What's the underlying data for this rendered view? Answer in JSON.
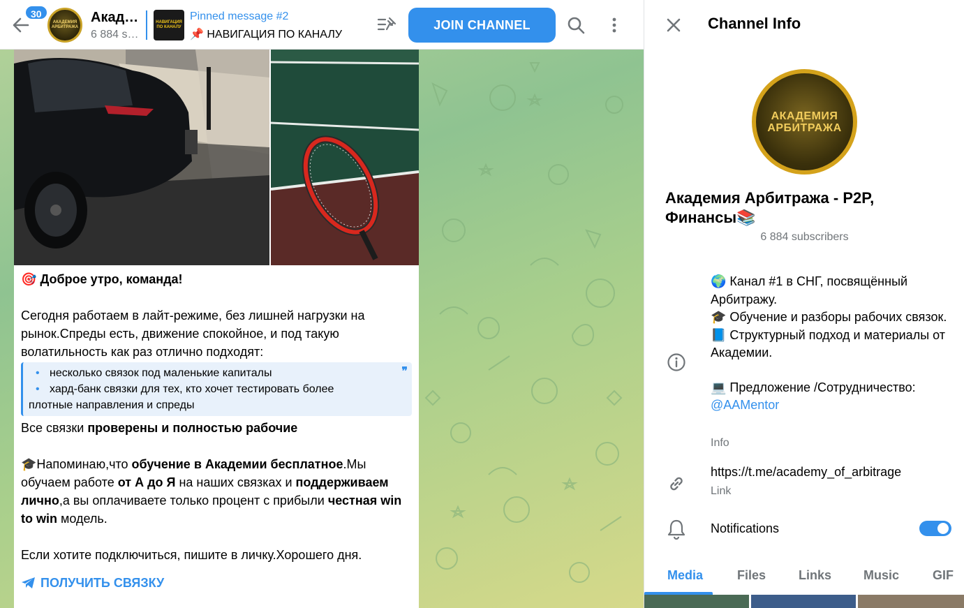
{
  "header": {
    "unread_count": "30",
    "chat_title": "Академия Арбитража - P2P, Финансы",
    "chat_subtitle": "6 884 subscribers",
    "avatar_text": "АКАДЕМИЯ АРБИТРАЖА",
    "pinned_title": "Pinned message #2",
    "pinned_thumb_text": "НАВИГАЦИЯ ПО КАНАЛУ",
    "pinned_text": "📌 НАВИГАЦИЯ ПО КАНАЛУ",
    "join_label": "JOIN CHANNEL"
  },
  "message": {
    "greeting_icon": "🎯",
    "greeting": "Доброе утро, команда!",
    "para1": "Сегодня работаем в лайт-режиме, без лишней нагрузки на рынок.Спреды есть, движение спокойное, и под такую волатильность как раз отлично подходят:",
    "quote_items": [
      "несколько связок под маленькие капиталы",
      "хард-банк связки для тех, кто хочет тестировать более",
      "плотные направления и спреды"
    ],
    "quote_mark": "❞",
    "checked_prefix": "Все связки ",
    "checked_bold": "проверены и полностью рабочие",
    "edu_icon": "🎓",
    "edu_1": "Напоминаю,что ",
    "edu_2": "обучение в Академии бесплатное",
    "edu_3": ".Мы обучаем работе ",
    "edu_4": "от А до Я",
    "edu_5": " на наших связках и ",
    "edu_6": "поддерживаем лично",
    "edu_7": ",а вы оплачиваете только процент с прибыли ",
    "edu_8": "честная win to win",
    "edu_9": " модель.",
    "closing": "Если хотите подключиться, пишите в личку.Хорошего дня.",
    "cta": "ПОЛУЧИТЬ СВЯЗКУ"
  },
  "info_panel": {
    "title": "Channel Info",
    "avatar_text_1": "АКАДЕМИЯ",
    "avatar_text_2": "АРБИТРАЖА",
    "channel_name": "Академия Арбитража - P2P, Финансы📚",
    "subscribers": "6 884 subscribers",
    "desc_1": "🌍 Канал #1 в СНГ, посвящённый Арбитражу.",
    "desc_2": "🎓 Обучение и разборы рабочих связок.",
    "desc_3": "📘 Структурный подход и материалы от Академии.",
    "desc_4": "💻 Предложение /Сотрудничество:",
    "desc_mention": "@AAMentor",
    "desc_label": "Info",
    "link_url": "https://t.me/academy_of_arbitrage",
    "link_label": "Link",
    "notifications_label": "Notifications",
    "notifications_on": true,
    "tabs": [
      "Media",
      "Files",
      "Links",
      "Music",
      "GIF"
    ],
    "active_tab": "Media"
  },
  "colors": {
    "accent": "#3390ec",
    "secondary_text": "#707579",
    "gold": "#d4a21b"
  },
  "icons": [
    "back-arrow-icon",
    "pin-list-icon",
    "search-icon",
    "more-vertical-icon",
    "close-icon",
    "info-icon",
    "link-icon",
    "bell-icon",
    "telegram-send-icon"
  ]
}
